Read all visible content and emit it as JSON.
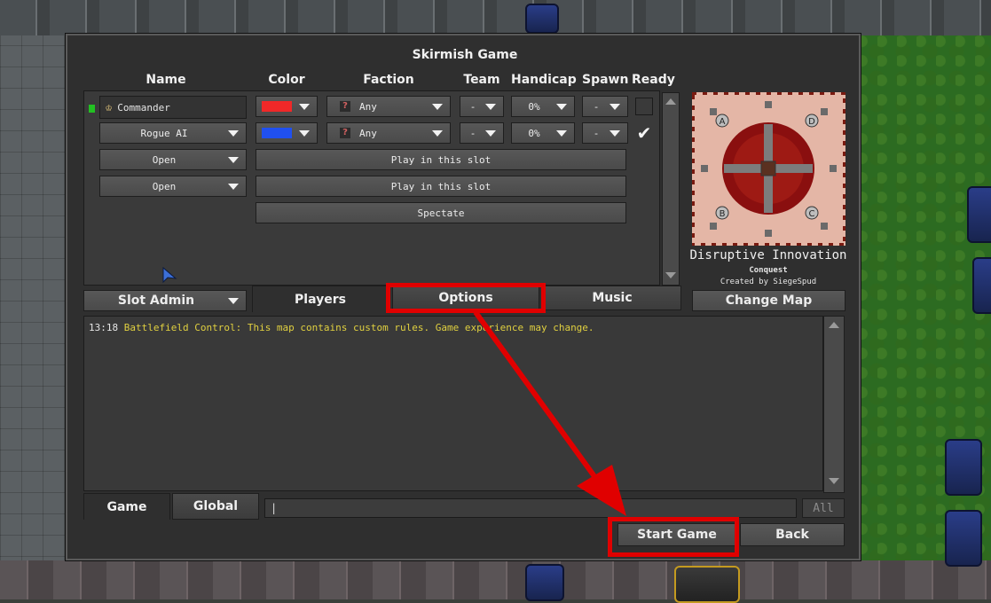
{
  "dialog": {
    "title": "Skirmish Game"
  },
  "columns": {
    "name": "Name",
    "color": "Color",
    "faction": "Faction",
    "team": "Team",
    "handicap": "Handicap",
    "spawn": "Spawn",
    "ready": "Ready"
  },
  "slots": [
    {
      "name": "Commander",
      "color": "#f02828",
      "faction": "Any",
      "team": "-",
      "handicap": "0%",
      "spawn": "-",
      "ready": false,
      "status_color": "#22c022"
    },
    {
      "name": "Rogue AI",
      "color": "#2050f0",
      "faction": "Any",
      "team": "-",
      "handicap": "0%",
      "spawn": "-",
      "ready": true
    }
  ],
  "open_slots": [
    {
      "name": "Open",
      "action": "Play in this slot"
    },
    {
      "name": "Open",
      "action": "Play in this slot"
    }
  ],
  "spectate_label": "Spectate",
  "slot_admin_label": "Slot Admin",
  "tabs": {
    "players": "Players",
    "options": "Options",
    "music": "Music"
  },
  "map": {
    "name": "Disruptive Innovation",
    "mode": "Conquest",
    "author": "Created by SiegeSpud",
    "change_label": "Change Map",
    "spawns": [
      "A",
      "D",
      "B",
      "C"
    ]
  },
  "chat": {
    "messages": [
      {
        "time": "13:18",
        "text": "Battlefield Control: This map contains custom rules. Game experience may change."
      }
    ],
    "input_value": "",
    "tabs": {
      "game": "Game",
      "global": "Global"
    },
    "target_label": "All"
  },
  "buttons": {
    "start": "Start Game",
    "back": "Back"
  },
  "annotation_color": "#e00000"
}
